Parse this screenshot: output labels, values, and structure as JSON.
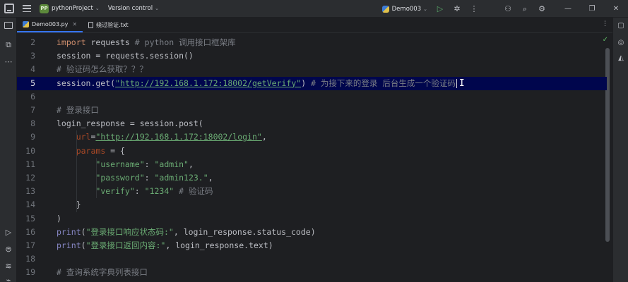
{
  "titlebar": {
    "project_badge": "PP",
    "project_name": "pythonProject",
    "version_control": "Version control",
    "run_config": "Demo003",
    "icons": [
      "run-icon",
      "debug-icon",
      "more-icon",
      "add-user-icon",
      "search-icon",
      "settings-icon"
    ],
    "window_controls": [
      "minimize-icon",
      "maximize-icon",
      "close-icon"
    ]
  },
  "tabs": [
    {
      "label": "Demo003.py",
      "icon": "python-file-icon",
      "active": true
    },
    {
      "label": "绕过验证.txt",
      "icon": "text-file-icon",
      "active": false
    }
  ],
  "editor": {
    "current_line": 5,
    "lines": [
      {
        "n": "2",
        "tokens": [
          [
            "kw",
            "import"
          ],
          [
            "p",
            " requests "
          ],
          [
            "cmt",
            "# python 调用接口框架库"
          ]
        ]
      },
      {
        "n": "3",
        "tokens": [
          [
            "p",
            "session = requests.session()"
          ]
        ]
      },
      {
        "n": "4",
        "tokens": [
          [
            "cmt",
            "# 验证码怎么获取？？？"
          ]
        ]
      },
      {
        "n": "5",
        "tokens": [
          [
            "p",
            "session.get("
          ],
          [
            "url",
            "\"http://192.168.1.172:18002/getVerify\""
          ],
          [
            "p",
            ") "
          ],
          [
            "cmt",
            "# 为接下来的登录 后台生成一个验证码"
          ]
        ]
      },
      {
        "n": "6",
        "tokens": []
      },
      {
        "n": "7",
        "tokens": [
          [
            "cmt",
            "# 登录接口"
          ]
        ]
      },
      {
        "n": "8",
        "tokens": [
          [
            "p",
            "login_response = session.post("
          ]
        ]
      },
      {
        "n": "9",
        "tokens": [
          [
            "p",
            "    "
          ],
          [
            "param",
            "url"
          ],
          [
            "p",
            "="
          ],
          [
            "url",
            "\"http://192.168.1.172:18002/login\""
          ],
          [
            "p",
            ","
          ]
        ]
      },
      {
        "n": "10",
        "tokens": [
          [
            "p",
            "    "
          ],
          [
            "param",
            "params"
          ],
          [
            "p",
            " = {"
          ]
        ]
      },
      {
        "n": "11",
        "tokens": [
          [
            "p",
            "        "
          ],
          [
            "str",
            "\"username\""
          ],
          [
            "p",
            ": "
          ],
          [
            "str",
            "\"admin\""
          ],
          [
            "p",
            ","
          ]
        ]
      },
      {
        "n": "12",
        "tokens": [
          [
            "p",
            "        "
          ],
          [
            "str",
            "\"password\""
          ],
          [
            "p",
            ": "
          ],
          [
            "str",
            "\"admin123.\""
          ],
          [
            "p",
            ","
          ]
        ]
      },
      {
        "n": "13",
        "tokens": [
          [
            "p",
            "        "
          ],
          [
            "str",
            "\"verify\""
          ],
          [
            "p",
            ": "
          ],
          [
            "str",
            "\"1234\""
          ],
          [
            "p",
            " "
          ],
          [
            "cmt",
            "# 验证码"
          ]
        ]
      },
      {
        "n": "14",
        "tokens": [
          [
            "p",
            "    }"
          ]
        ]
      },
      {
        "n": "15",
        "tokens": [
          [
            "p",
            ")"
          ]
        ]
      },
      {
        "n": "16",
        "tokens": [
          [
            "fn",
            "print"
          ],
          [
            "p",
            "("
          ],
          [
            "str",
            "\"登录接口响应状态码:\""
          ],
          [
            "p",
            ", login_response.status_code)"
          ]
        ]
      },
      {
        "n": "17",
        "tokens": [
          [
            "fn",
            "print"
          ],
          [
            "p",
            "("
          ],
          [
            "str",
            "\"登录接口返回内容:\""
          ],
          [
            "p",
            ", login_response.text)"
          ]
        ]
      },
      {
        "n": "18",
        "tokens": []
      },
      {
        "n": "19",
        "tokens": [
          [
            "cmt",
            "# 查询系统字典列表接口"
          ]
        ]
      }
    ]
  },
  "colors": {
    "background": "#1e1f22",
    "panel": "#2b2d30",
    "current_line": "#00064d",
    "keyword": "#cf8e6d",
    "string": "#6aab73",
    "comment": "#7a7e85",
    "param": "#aa4926",
    "builtin": "#8888c6",
    "accent": "#3574f0"
  }
}
